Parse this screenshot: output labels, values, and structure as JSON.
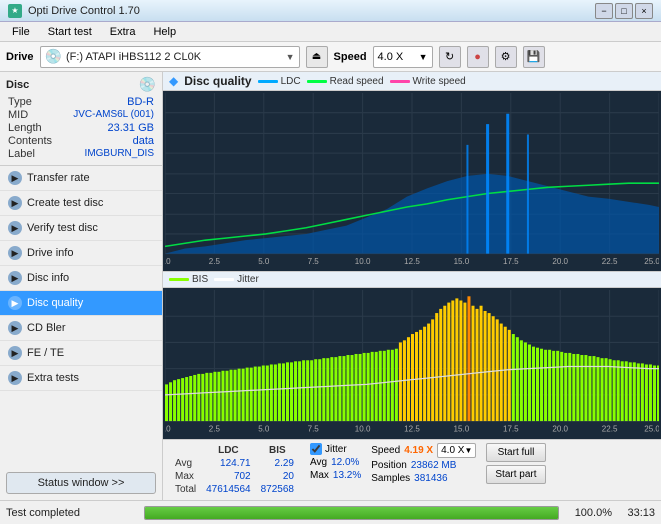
{
  "titlebar": {
    "title": "Opti Drive Control 1.70",
    "icon": "★",
    "btn_minimize": "−",
    "btn_maximize": "□",
    "btn_close": "×"
  },
  "menubar": {
    "items": [
      "File",
      "Start test",
      "Extra",
      "Help"
    ]
  },
  "drive_toolbar": {
    "drive_label": "Drive",
    "drive_value": "(F:)  ATAPI iHBS112  2 CL0K",
    "eject_icon": "⏏",
    "speed_label": "Speed",
    "speed_value": "4.0 X",
    "icon_refresh": "↻",
    "icon_disc": "●",
    "icon_settings": "⚙",
    "icon_save": "💾"
  },
  "disc_panel": {
    "title": "Disc",
    "icon": "💿",
    "rows": [
      {
        "key": "Type",
        "val": "BD-R"
      },
      {
        "key": "MID",
        "val": "JVC-AMS6L (001)"
      },
      {
        "key": "Length",
        "val": "23.31 GB"
      },
      {
        "key": "Contents",
        "val": "data"
      },
      {
        "key": "Label",
        "val": "IMGBURN_DIS"
      }
    ]
  },
  "sidebar": {
    "items": [
      {
        "label": "Transfer rate",
        "active": false
      },
      {
        "label": "Create test disc",
        "active": false
      },
      {
        "label": "Verify test disc",
        "active": false
      },
      {
        "label": "Drive info",
        "active": false
      },
      {
        "label": "Disc info",
        "active": false
      },
      {
        "label": "Disc quality",
        "active": true
      },
      {
        "label": "CD Bler",
        "active": false
      },
      {
        "label": "FE / TE",
        "active": false
      },
      {
        "label": "Extra tests",
        "active": false
      }
    ],
    "status_btn": "Status window >>"
  },
  "chart": {
    "header_icon": "◆",
    "header_title": "Disc quality",
    "legend": [
      {
        "label": "LDC",
        "color": "#00aaff"
      },
      {
        "label": "Read speed",
        "color": "#00ff44"
      },
      {
        "label": "Write speed",
        "color": "#ff44aa"
      }
    ],
    "legend2": [
      {
        "label": "BIS",
        "color": "#88ff00"
      },
      {
        "label": "Jitter",
        "color": "#ffffff"
      }
    ]
  },
  "stats": {
    "col_headers": [
      "LDC",
      "BIS"
    ],
    "rows": [
      {
        "label": "Avg",
        "ldc": "124.71",
        "bis": "2.29"
      },
      {
        "label": "Max",
        "ldc": "702",
        "bis": "20"
      },
      {
        "label": "Total",
        "ldc": "47614564",
        "bis": "872568"
      }
    ],
    "jitter_label": "Jitter",
    "jitter_checked": true,
    "jitter_avg": "12.0%",
    "jitter_max": "13.2%",
    "speed_label": "Speed",
    "speed_val": "4.19 X",
    "speed_sel": "4.0 X",
    "position_label": "Position",
    "position_val": "23862 MB",
    "samples_label": "Samples",
    "samples_val": "381436",
    "btn_start_full": "Start full",
    "btn_start_part": "Start part"
  },
  "statusbar": {
    "status_text": "Test completed",
    "progress_pct": 100,
    "progress_display": "100.0%",
    "time": "33:13"
  }
}
